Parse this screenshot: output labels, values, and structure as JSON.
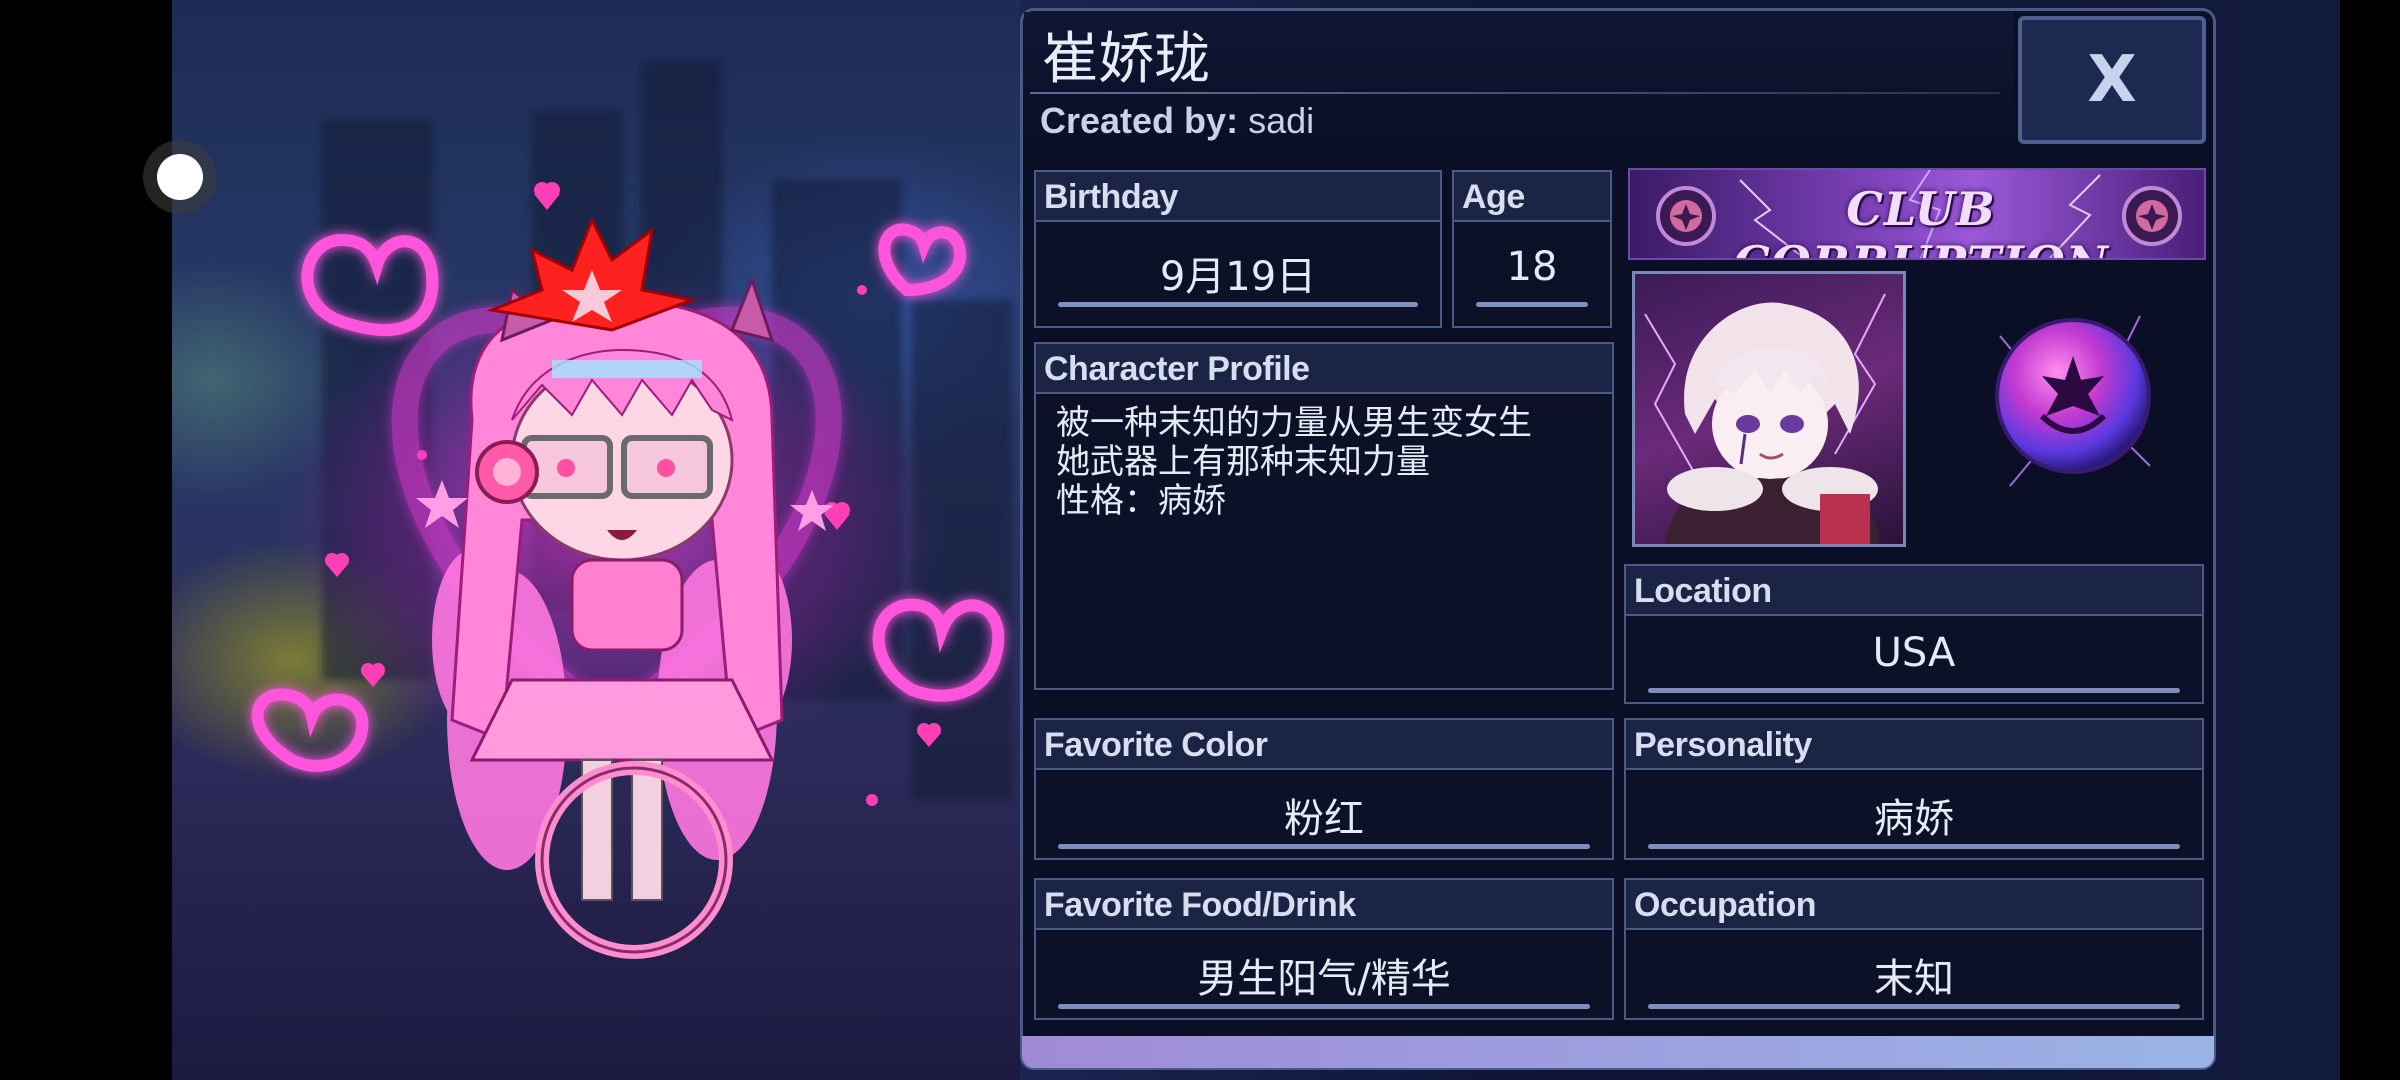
{
  "character": {
    "name": "崔娇珑",
    "created_by_label": "Created by:",
    "created_by_value": "sadi"
  },
  "close_label": "X",
  "fields": {
    "birthday": {
      "label": "Birthday",
      "value": "9月19日"
    },
    "age": {
      "label": "Age",
      "value": "18"
    },
    "profile": {
      "label": "Character Profile",
      "text": "被一种末知的力量从男生变女生\n她武器上有那种末知力量\n性格：病娇"
    },
    "location": {
      "label": "Location",
      "value": "USA"
    },
    "favorite_color": {
      "label": "Favorite Color",
      "value": "粉红"
    },
    "personality": {
      "label": "Personality",
      "value": "病娇"
    },
    "favorite_food": {
      "label": "Favorite Food/Drink",
      "value": "男生阳气/精华"
    },
    "occupation": {
      "label": "Occupation",
      "value": "末知"
    }
  },
  "club_banner": "CLUB CORRUPTION",
  "colors": {
    "panel_bg": "#0b0f25",
    "border": "#4a5a86",
    "label_bg": "#1b2445",
    "accent_pink": "#ff4fd8",
    "footer_gradient_start": "#a08ad8"
  }
}
